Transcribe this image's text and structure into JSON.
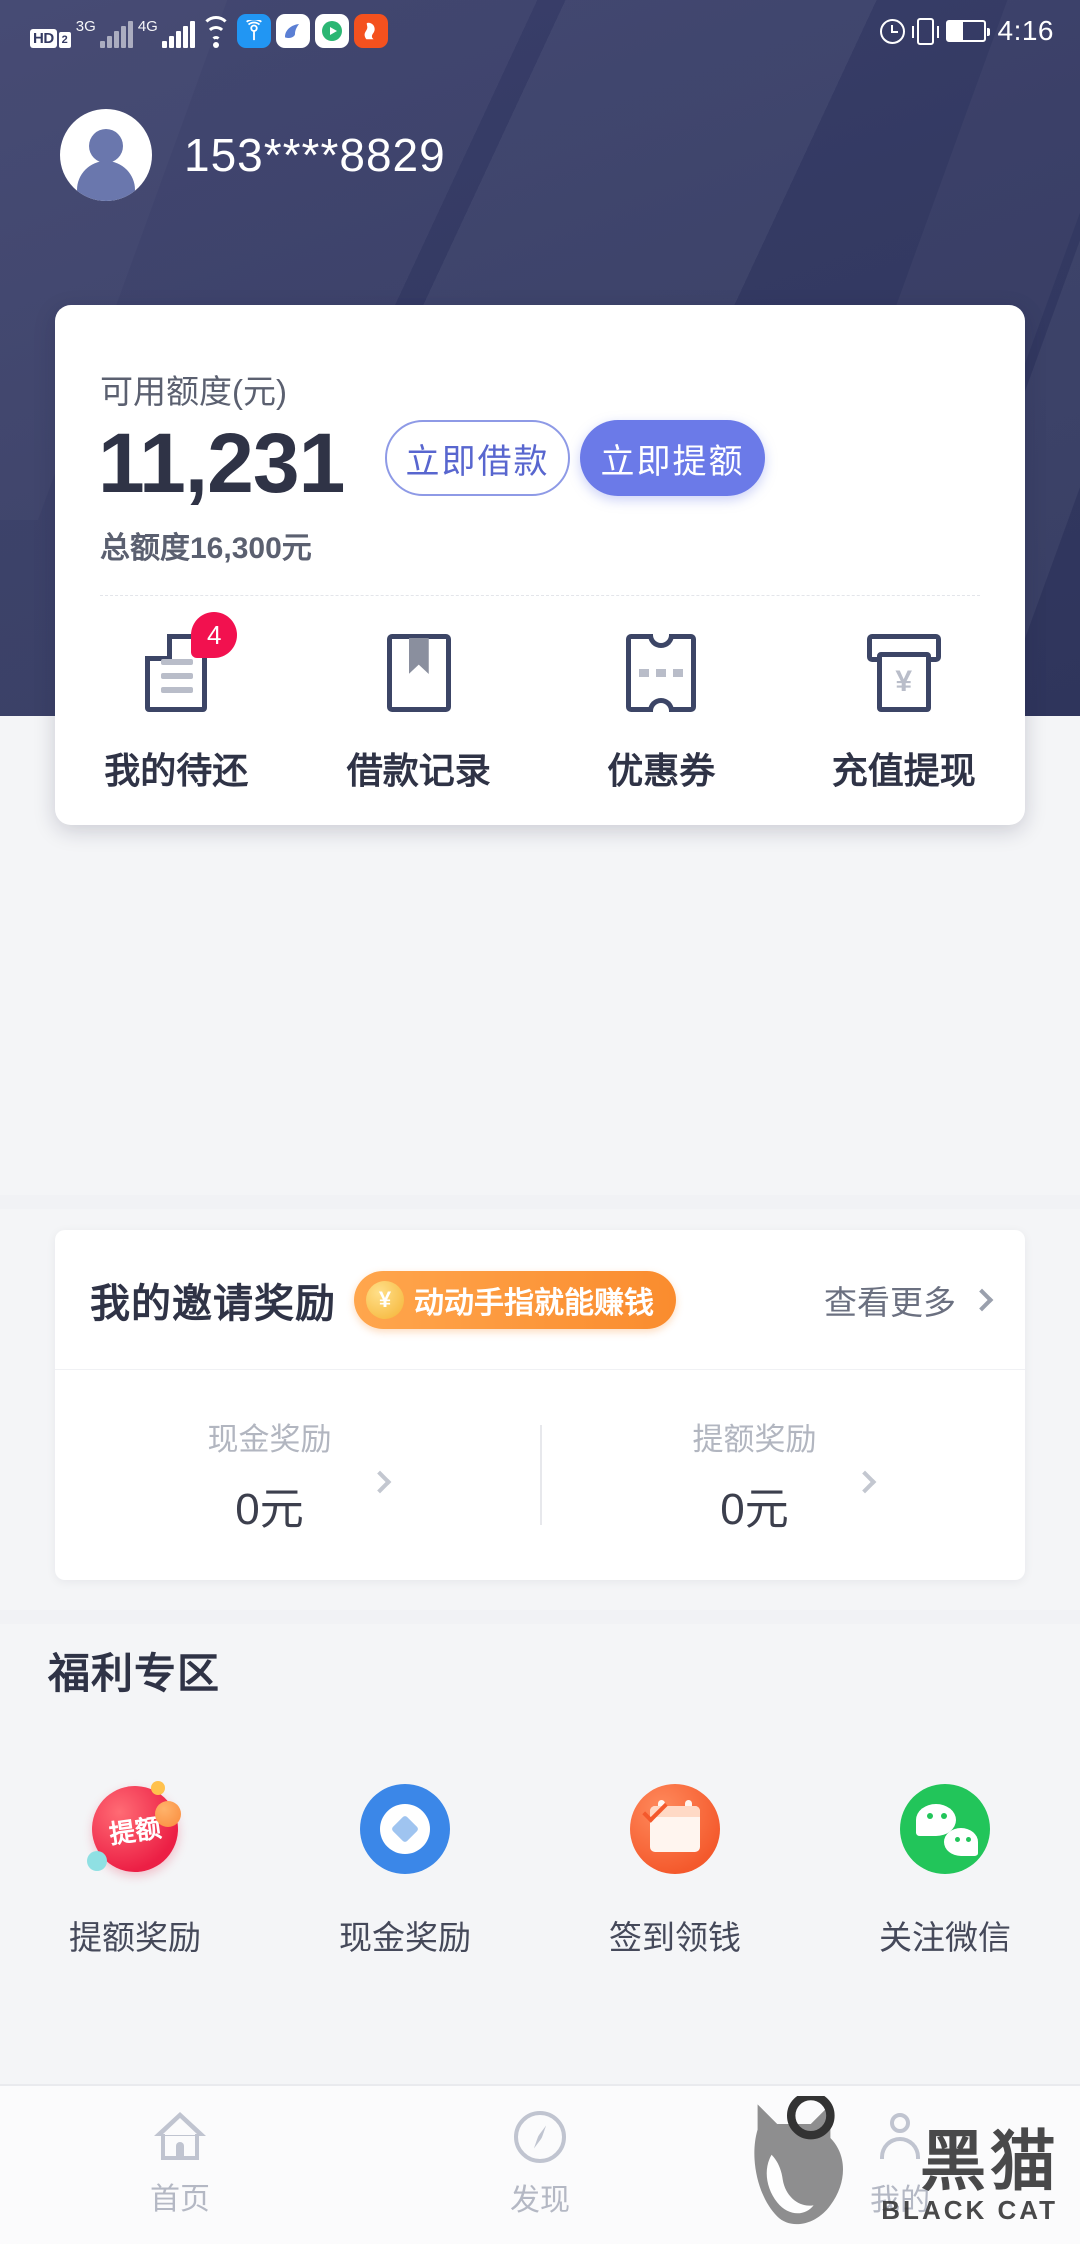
{
  "status_bar": {
    "hd_label": "HD",
    "sim_label": "2",
    "network_1": "3G",
    "network_2": "4G",
    "icons": [
      "hd-icon",
      "sim-icon",
      "3g-signal-icon",
      "4g-signal-icon",
      "wifi-icon",
      "gps-icon",
      "cloud-app-icon",
      "play-app-icon",
      "uc-browser-icon",
      "alarm-icon",
      "vibrate-icon",
      "battery-icon"
    ],
    "time": "4:16"
  },
  "profile": {
    "phone": "153****8829",
    "avatar": "user-avatar"
  },
  "credit_card": {
    "available_label": "可用额度(元)",
    "available_amount": "11,231",
    "total_label": "总额度16,300元",
    "borrow_button": "立即借款",
    "raise_button": "立即提额",
    "accent_outline": "#5866cf",
    "accent_fill": "#6b7ae8",
    "quick_actions": [
      {
        "label": "我的待还",
        "icon": "document-icon",
        "badge": "4"
      },
      {
        "label": "借款记录",
        "icon": "bookmark-icon",
        "badge": ""
      },
      {
        "label": "优惠券",
        "icon": "coupon-ticket-icon",
        "badge": ""
      },
      {
        "label": "充值提现",
        "icon": "atm-yuan-icon",
        "badge": ""
      }
    ]
  },
  "invite": {
    "title": "我的邀请奖励",
    "tag": "动动手指就能赚钱",
    "tag_color": "#fa8c2e",
    "more": "查看更多",
    "stats": [
      {
        "name": "现金奖励",
        "value": "0元"
      },
      {
        "name": "提额奖励",
        "value": "0元"
      }
    ]
  },
  "welfare": {
    "title": "福利专区",
    "items": [
      {
        "label": "提额奖励",
        "icon": "raise-credit-ball-icon",
        "badge_text": "提额",
        "color": "#ec1f45"
      },
      {
        "label": "现金奖励",
        "icon": "cash-reward-circle-icon",
        "badge_text": "",
        "color": "#3b87e8"
      },
      {
        "label": "签到领钱",
        "icon": "checkin-calendar-icon",
        "badge_text": "",
        "color": "#f4592c"
      },
      {
        "label": "关注微信",
        "icon": "wechat-icon",
        "badge_text": "",
        "color": "#22c55a"
      }
    ]
  },
  "bottom_nav": {
    "items": [
      {
        "label": "首页",
        "icon": "home-icon"
      },
      {
        "label": "发现",
        "icon": "compass-icon"
      },
      {
        "label": "我的",
        "icon": "person-icon"
      }
    ]
  },
  "watermark": {
    "text": "黑猫",
    "sub": "BLACK CAT"
  }
}
